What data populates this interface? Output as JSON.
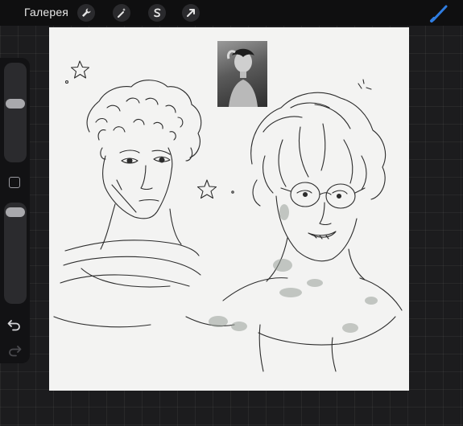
{
  "topbar": {
    "gallery_label": "Галерея",
    "tools": [
      {
        "name": "actions",
        "icon": "wrench-icon"
      },
      {
        "name": "adjustments",
        "icon": "magic-wand-icon"
      },
      {
        "name": "selection",
        "icon": "selection-s-icon"
      },
      {
        "name": "transform",
        "icon": "arrow-cursor-icon"
      }
    ],
    "brush_icon": "brush-icon",
    "accent_color": "#2f7de1"
  },
  "sidebar": {
    "brush_size_level": 0.7,
    "opacity_level": 0.95,
    "modify_icon": "square-icon",
    "undo_icon": "undo-arrow-icon",
    "redo_icon": "redo-arrow-icon"
  },
  "canvas": {
    "background": "#f3f3f2",
    "reference_image": "reference-photo",
    "decorations": [
      "star-icon",
      "star-icon"
    ]
  }
}
